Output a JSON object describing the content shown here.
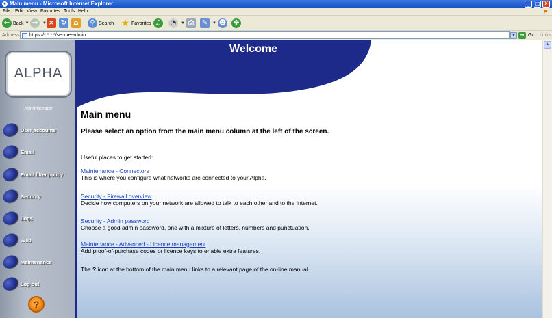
{
  "window": {
    "title": "Main menu - Microsoft Internet Explorer",
    "controls": {
      "minimize": "_",
      "maximize": "□",
      "close": "X"
    }
  },
  "menubar": [
    "File",
    "Edit",
    "View",
    "Favorites",
    "Tools",
    "Help"
  ],
  "toolbar": {
    "back": "Back",
    "search": "Search",
    "favorites": "Favorites"
  },
  "addressbar": {
    "label": "Address",
    "url": "https://*.*.*.*/secure-admin",
    "go": "Go",
    "links": "Links"
  },
  "sidebar": {
    "logo": "ALPHA",
    "role": "Administrator",
    "items": [
      {
        "label": "User accounts"
      },
      {
        "label": "Email"
      },
      {
        "label": "Email filter policy"
      },
      {
        "label": "Security"
      },
      {
        "label": "Logs"
      },
      {
        "label": "Web"
      },
      {
        "label": "Maintenance"
      },
      {
        "label": "Log out"
      }
    ],
    "help_icon": "?"
  },
  "header": {
    "welcome": "Welcome"
  },
  "main": {
    "title": "Main menu",
    "lead": "Please select an option from the main menu column at the left of the screen.",
    "useful": "Useful places to get started:",
    "entries": [
      {
        "link": "Maintenance - Connectors",
        "desc": "This is where you configure what networks are connected to your Alpha."
      },
      {
        "link": "Security - Firewall overview",
        "desc": "Decide how computers on your network are allowed to talk to each other and to the Internet."
      },
      {
        "link": "Security - Admin password",
        "desc": "Choose a good admin password, one with a mixture of letters, numbers and punctuation."
      },
      {
        "link": "Maintenance - Advanced - Licence management",
        "desc": "Add proof-of-purchase codes or licence keys to enable extra features."
      }
    ],
    "footnote_pre": "The ",
    "footnote_icon": "?",
    "footnote_post": " icon at the bottom of the main menu links to a relevant page of the on-line manual."
  }
}
